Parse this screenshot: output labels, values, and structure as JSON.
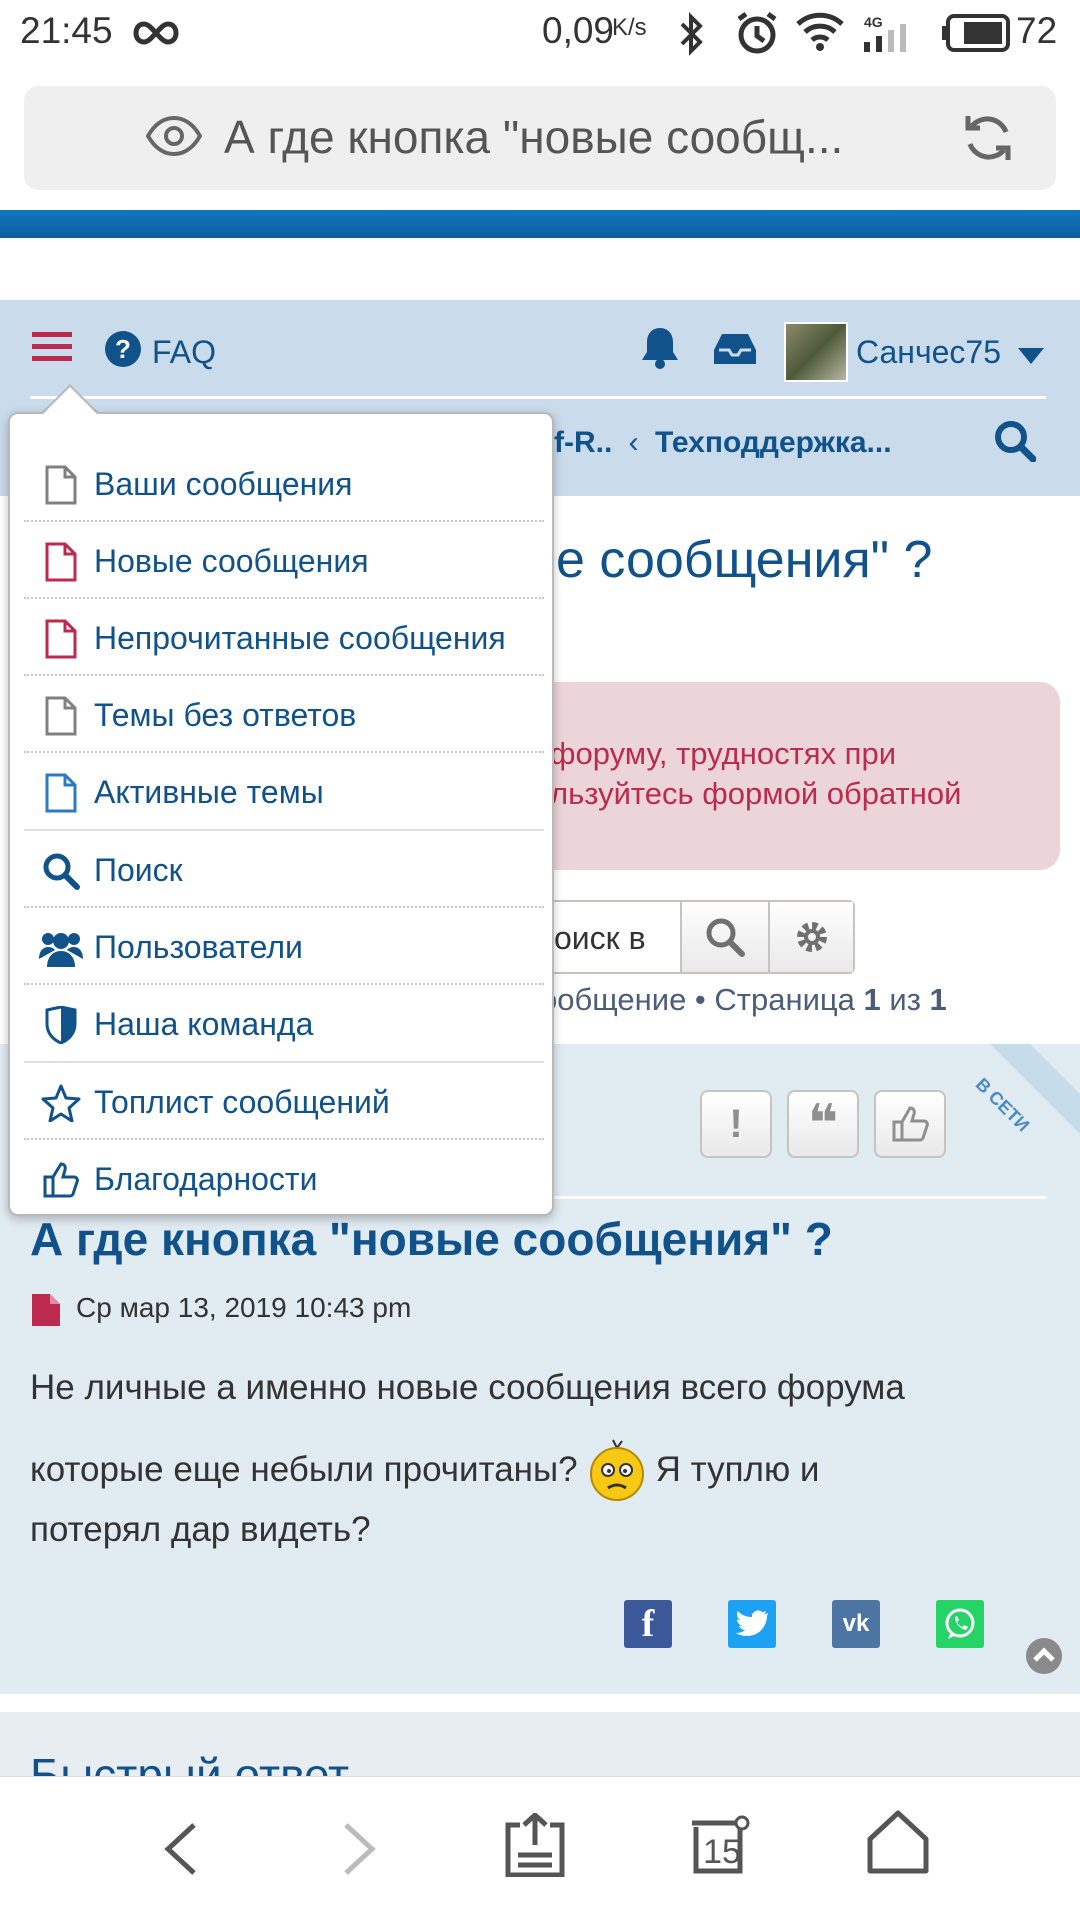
{
  "status_bar": {
    "time": "21:45",
    "network_speed": "0,09",
    "speed_unit": "K/s",
    "network_type": "4G",
    "battery": "72"
  },
  "browser": {
    "url_title": "А где кнопка \"новые сообщ..."
  },
  "forum_nav": {
    "faq": "FAQ",
    "username": "Санчес75",
    "breadcrumb_partial": "f-R..",
    "breadcrumb_sep": "‹",
    "breadcrumb_current": "Техподдержка..."
  },
  "topic": {
    "title_partial": "е сообщения\" ?"
  },
  "notice": {
    "line1": "форуму, трудностях при",
    "line2": "льзуйтесь формой обратной"
  },
  "search": {
    "placeholder_partial": "оиск в"
  },
  "pagination": {
    "prefix": "ообщение • Страница ",
    "current": "1",
    "of": " из ",
    "total": "1"
  },
  "online_ribbon": "В СЕТИ",
  "post": {
    "title": "А где кнопка \"новые сообщения\" ?",
    "date": "Ср мар 13, 2019 10:43 pm",
    "body_line1": "Не личные а именно новые сообщения всего форума",
    "body_line2a": "которые еще небыли прочитаны?",
    "body_line2b": "Я туплю и",
    "body_line3": "потерял дар видеть?"
  },
  "quick_reply": "Быстрый ответ",
  "menu": {
    "items": [
      {
        "label": "Ваши сообщения",
        "icon": "file-icon"
      },
      {
        "label": "Новые сообщения",
        "icon": "file-red-icon"
      },
      {
        "label": "Непрочитанные сообщения",
        "icon": "file-red-icon"
      },
      {
        "label": "Темы без ответов",
        "icon": "file-icon"
      },
      {
        "label": "Активные темы",
        "icon": "file-blue-icon"
      },
      {
        "label": "Поиск",
        "icon": "search-icon"
      },
      {
        "label": "Пользователи",
        "icon": "users-icon"
      },
      {
        "label": "Наша команда",
        "icon": "shield-icon"
      },
      {
        "label": "Топлист сообщений",
        "icon": "star-icon"
      },
      {
        "label": "Благодарности",
        "icon": "thumbs-up-icon"
      }
    ]
  },
  "tabs_count": "15",
  "colors": {
    "link_blue": "#105289",
    "accent_bar": "#1475c0",
    "menu_red": "#bc2a4d",
    "header_bg": "#cadcec",
    "post_bg": "#e1ebf2"
  }
}
